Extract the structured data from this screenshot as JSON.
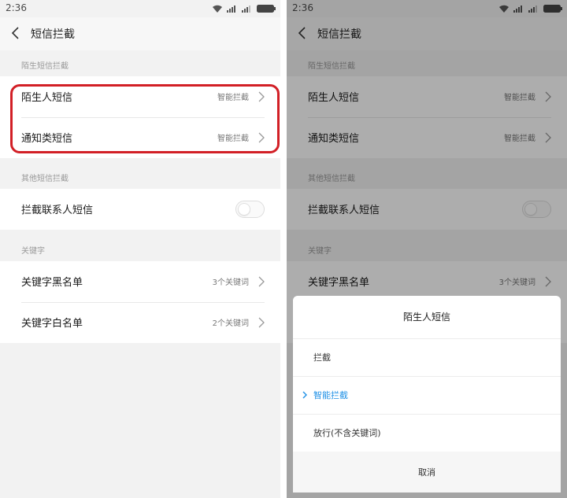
{
  "status": {
    "time": "2:36"
  },
  "header": {
    "title": "短信拦截"
  },
  "sections": {
    "stranger": {
      "label": "陌生短信拦截"
    },
    "other": {
      "label": "其他短信拦截"
    },
    "keyword": {
      "label": "关键字"
    }
  },
  "rows": {
    "stranger_sms": {
      "label": "陌生人短信",
      "value": "智能拦截"
    },
    "notify_sms": {
      "label": "通知类短信",
      "value": "智能拦截"
    },
    "block_contacts": {
      "label": "拦截联系人短信",
      "toggle": "off"
    },
    "blacklist": {
      "label": "关键字黑名单",
      "value": "3个关键词"
    },
    "whitelist": {
      "label": "关键字白名单",
      "value": "2个关键词"
    }
  },
  "dialog": {
    "title": "陌生人短信",
    "options": [
      "拦截",
      "智能拦截",
      "放行(不含关键词)"
    ],
    "selected": "智能拦截",
    "cancel": "取消"
  },
  "colors": {
    "highlight": "#d21f26",
    "accent": "#1e90e6"
  },
  "icons": [
    "wifi-icon",
    "signal-icon",
    "battery-icon",
    "back-icon",
    "chevron-right-icon",
    "check-icon"
  ]
}
